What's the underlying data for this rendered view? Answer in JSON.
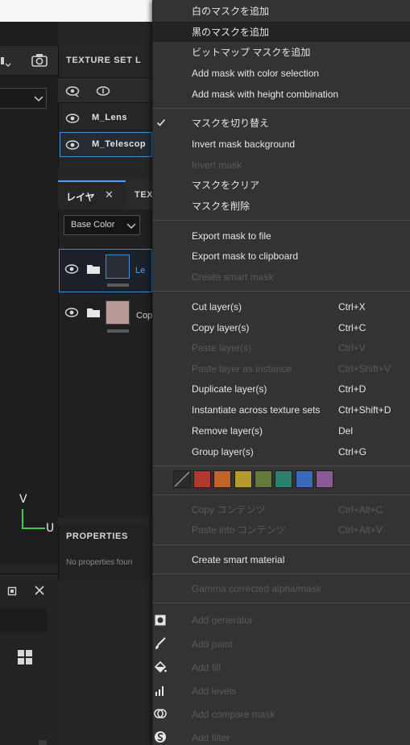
{
  "viewport": {
    "axis_v": "V",
    "axis_u": "U"
  },
  "texture_set_panel": {
    "title": "TEXTURE SET L",
    "items": [
      {
        "label": "M_Lens"
      },
      {
        "label": "M_Telescop"
      }
    ]
  },
  "layers_panel": {
    "tab_active": "レイヤ",
    "tab_close": "✕",
    "tab_next": "TEX",
    "channel": "Base Color",
    "layers": [
      {
        "label": "Le",
        "thumb_color": "#2a2f36",
        "selected": true
      },
      {
        "label": "Cop",
        "thumb_color": "#b89a96",
        "selected": false
      }
    ]
  },
  "properties_panel": {
    "title": "PROPERTIES",
    "empty_text": "No properties foun"
  },
  "context_menu": {
    "items": [
      {
        "id": "add-white-mask",
        "label": "白のマスクを追加",
        "shortcut": "",
        "enabled": true
      },
      {
        "id": "add-black-mask",
        "label": "黒のマスクを追加",
        "shortcut": "",
        "enabled": true,
        "highlighted": true
      },
      {
        "id": "add-bitmap-mask",
        "label": "ビットマップ マスクを追加",
        "shortcut": "",
        "enabled": true
      },
      {
        "id": "add-mask-color-selection",
        "label": "Add mask with color selection",
        "shortcut": "",
        "enabled": true
      },
      {
        "id": "add-mask-height-combination",
        "label": "Add mask with height combination",
        "shortcut": "",
        "enabled": true
      },
      {
        "id": "toggle-mask",
        "label": "マスクを切り替え",
        "shortcut": "",
        "enabled": true,
        "checked": true
      },
      {
        "id": "invert-mask-background",
        "label": "Invert mask background",
        "shortcut": "",
        "enabled": true
      },
      {
        "id": "invert-mask",
        "label": "Invert mask",
        "shortcut": "",
        "enabled": false
      },
      {
        "id": "clear-mask",
        "label": "マスクをクリア",
        "shortcut": "",
        "enabled": true
      },
      {
        "id": "delete-mask",
        "label": "マスクを削除",
        "shortcut": "",
        "enabled": true
      },
      {
        "id": "export-mask-file",
        "label": "Export mask to file",
        "shortcut": "",
        "enabled": true
      },
      {
        "id": "export-mask-clipboard",
        "label": "Export mask to clipboard",
        "shortcut": "",
        "enabled": true
      },
      {
        "id": "create-smart-mask",
        "label": "Create smart mask",
        "shortcut": "",
        "enabled": false
      },
      {
        "id": "cut-layers",
        "label": "Cut layer(s)",
        "shortcut": "Ctrl+X",
        "enabled": true
      },
      {
        "id": "copy-layers",
        "label": "Copy layer(s)",
        "shortcut": "Ctrl+C",
        "enabled": true
      },
      {
        "id": "paste-layers",
        "label": "Paste layer(s)",
        "shortcut": "Ctrl+V",
        "enabled": false
      },
      {
        "id": "paste-layer-instance",
        "label": "Paste layer as instance",
        "shortcut": "Ctrl+Shift+V",
        "enabled": false
      },
      {
        "id": "duplicate-layers",
        "label": "Duplicate layer(s)",
        "shortcut": "Ctrl+D",
        "enabled": true
      },
      {
        "id": "instantiate-texture-sets",
        "label": "Instantiate across texture sets",
        "shortcut": "Ctrl+Shift+D",
        "enabled": true
      },
      {
        "id": "remove-layers",
        "label": "Remove layer(s)",
        "shortcut": "Del",
        "enabled": true
      },
      {
        "id": "group-layers",
        "label": "Group layer(s)",
        "shortcut": "Ctrl+G",
        "enabled": true
      },
      {
        "id": "copy-contents",
        "label": "Copy コンテンツ",
        "shortcut": "Ctrl+Alt+C",
        "enabled": false
      },
      {
        "id": "paste-into-contents",
        "label": "Paste into コンテンツ",
        "shortcut": "Ctrl+Alt+V",
        "enabled": false
      },
      {
        "id": "create-smart-material",
        "label": "Create smart material",
        "shortcut": "",
        "enabled": true
      },
      {
        "id": "gamma-corrected",
        "label": "Gamma corrected alpha/mask",
        "shortcut": "",
        "enabled": false
      },
      {
        "id": "add-generator",
        "label": "Add generator",
        "shortcut": "",
        "enabled": false,
        "icon": "generator-icon"
      },
      {
        "id": "add-paint",
        "label": "Add paint",
        "shortcut": "",
        "enabled": false,
        "icon": "brush-icon"
      },
      {
        "id": "add-fill",
        "label": "Add fill",
        "shortcut": "",
        "enabled": false,
        "icon": "fill-bucket-icon"
      },
      {
        "id": "add-levels",
        "label": "Add levels",
        "shortcut": "",
        "enabled": false,
        "icon": "levels-icon"
      },
      {
        "id": "add-compare-mask",
        "label": "Add compare mask",
        "shortcut": "",
        "enabled": false,
        "icon": "compare-mask-icon"
      },
      {
        "id": "add-filter",
        "label": "Add filter",
        "shortcut": "",
        "enabled": false,
        "icon": "filter-icon"
      }
    ],
    "color_swatches": [
      "none",
      "#b03a2e",
      "#c0652a",
      "#b59a2e",
      "#627a3e",
      "#2f7f6e",
      "#3a6ab8",
      "#8a5a96"
    ]
  }
}
